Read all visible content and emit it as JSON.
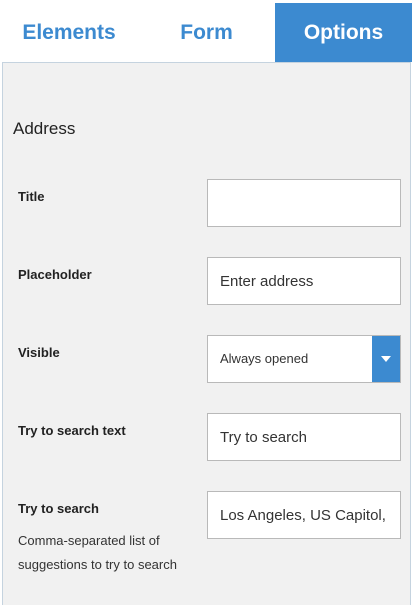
{
  "tabs": {
    "elements": "Elements",
    "form": "Form",
    "options": "Options",
    "active": "Options"
  },
  "section": {
    "title": "Address"
  },
  "fields": {
    "title": {
      "label": "Title",
      "value": "",
      "placeholder": ""
    },
    "placeholder": {
      "label": "Placeholder",
      "value": "Enter address"
    },
    "visible": {
      "label": "Visible",
      "selected": "Always opened"
    },
    "try_to_search_text": {
      "label": "Try to search text",
      "value": "Try to search"
    },
    "try_to_search": {
      "label": "Try to search",
      "description": "Comma-separated list of suggestions to try to search",
      "value": "Los Angeles, US Capitol,"
    }
  },
  "colors": {
    "accent": "#3c8ad0",
    "panel_bg": "#f1f1f1"
  },
  "icons": {
    "dropdown": "caret-down-icon"
  }
}
